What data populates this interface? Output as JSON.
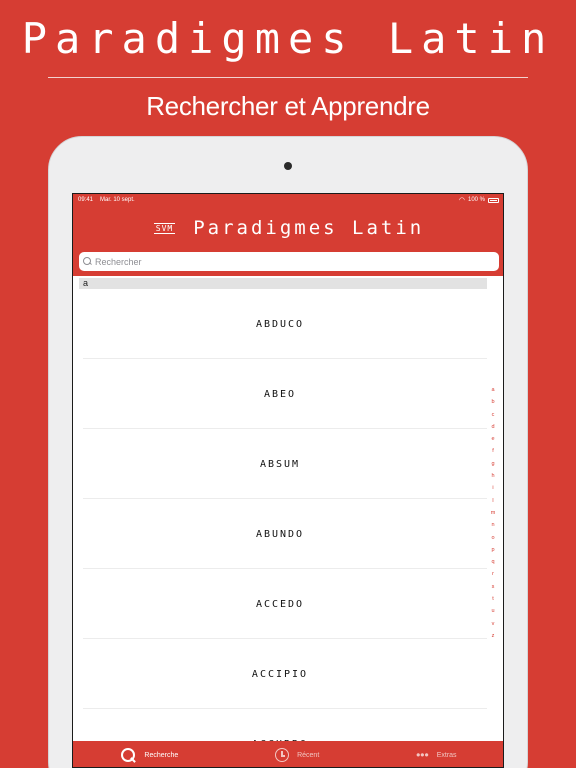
{
  "promo": {
    "title": "Paradigmes Latin",
    "subtitle": "Rechercher et Apprendre"
  },
  "status_bar": {
    "time": "09:41",
    "date": "Mar. 10 sept.",
    "battery": "100 %"
  },
  "nav": {
    "logo": "SVM",
    "title": "Paradigmes Latin"
  },
  "search": {
    "placeholder": "Rechercher"
  },
  "section_header": "a",
  "words": [
    "ABDUCO",
    "ABEO",
    "ABSUM",
    "ABUNDO",
    "ACCEDO",
    "ACCIPIO",
    "ACCURRO"
  ],
  "index_letters": [
    "a",
    "b",
    "c",
    "d",
    "e",
    "f",
    "g",
    "h",
    "i",
    "l",
    "m",
    "n",
    "o",
    "p",
    "q",
    "r",
    "s",
    "t",
    "u",
    "v",
    "z"
  ],
  "tabs": [
    {
      "label": "Recherche",
      "icon": "search-icon",
      "active": true
    },
    {
      "label": "Récent",
      "icon": "clock-icon",
      "active": false
    },
    {
      "label": "Extras",
      "icon": "more-icon",
      "active": false
    }
  ],
  "colors": {
    "accent": "#d63d33",
    "background": "#ffffff"
  }
}
